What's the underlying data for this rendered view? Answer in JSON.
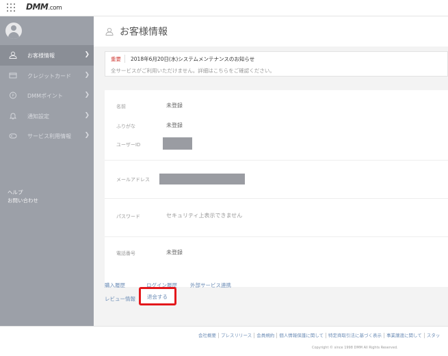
{
  "header": {
    "logo_main": "DMM",
    "logo_suffix": ".com"
  },
  "sidebar": {
    "items": [
      {
        "label": "お客様情報",
        "icon": "user-icon",
        "active": true
      },
      {
        "label": "クレジットカード",
        "icon": "credit-card-icon",
        "active": false
      },
      {
        "label": "DMMポイント",
        "icon": "points-icon",
        "active": false
      },
      {
        "label": "通知設定",
        "icon": "bell-icon",
        "active": false
      },
      {
        "label": "サービス利用情報",
        "icon": "gamepad-icon",
        "active": false
      }
    ],
    "help": "ヘルプ",
    "contact": "お問い合わせ"
  },
  "main": {
    "title": "お客様情報",
    "notice": {
      "badge": "重要",
      "headline": "2018年6月20日(水)システムメンテナンスのお知らせ",
      "sub": "全サービスがご利用いただけません。詳細はこちらをご確認ください。"
    },
    "fields": {
      "name_label": "名前",
      "name_value": "未登録",
      "furigana_label": "ふりがな",
      "furigana_value": "未登録",
      "userid_label": "ユーザーID",
      "email_label": "メールアドレス",
      "password_label": "パスワード",
      "password_value": "セキュリティ上表示できません",
      "phone_label": "電話番号",
      "phone_value": "未登録"
    },
    "links": {
      "purchase_history": "購入履歴",
      "login_history": "ログイン履歴",
      "external_services": "外部サービス連携",
      "review_info": "レビュー情報",
      "withdraw": "退会する"
    }
  },
  "footer": {
    "links": [
      "会社概要",
      "プレスリリース",
      "会員規約",
      "個人情報保護に関して",
      "特定商取引法に基づく表示",
      "事業譲渡に関して",
      "スタッ"
    ],
    "copyright": "Copyright © since 1998 DMM All Rights Reserved."
  },
  "colors": {
    "sidebar": "#9ca0a8",
    "accent_link": "#6a8bb5",
    "important": "#d0413b",
    "highlight": "#e3171b"
  }
}
